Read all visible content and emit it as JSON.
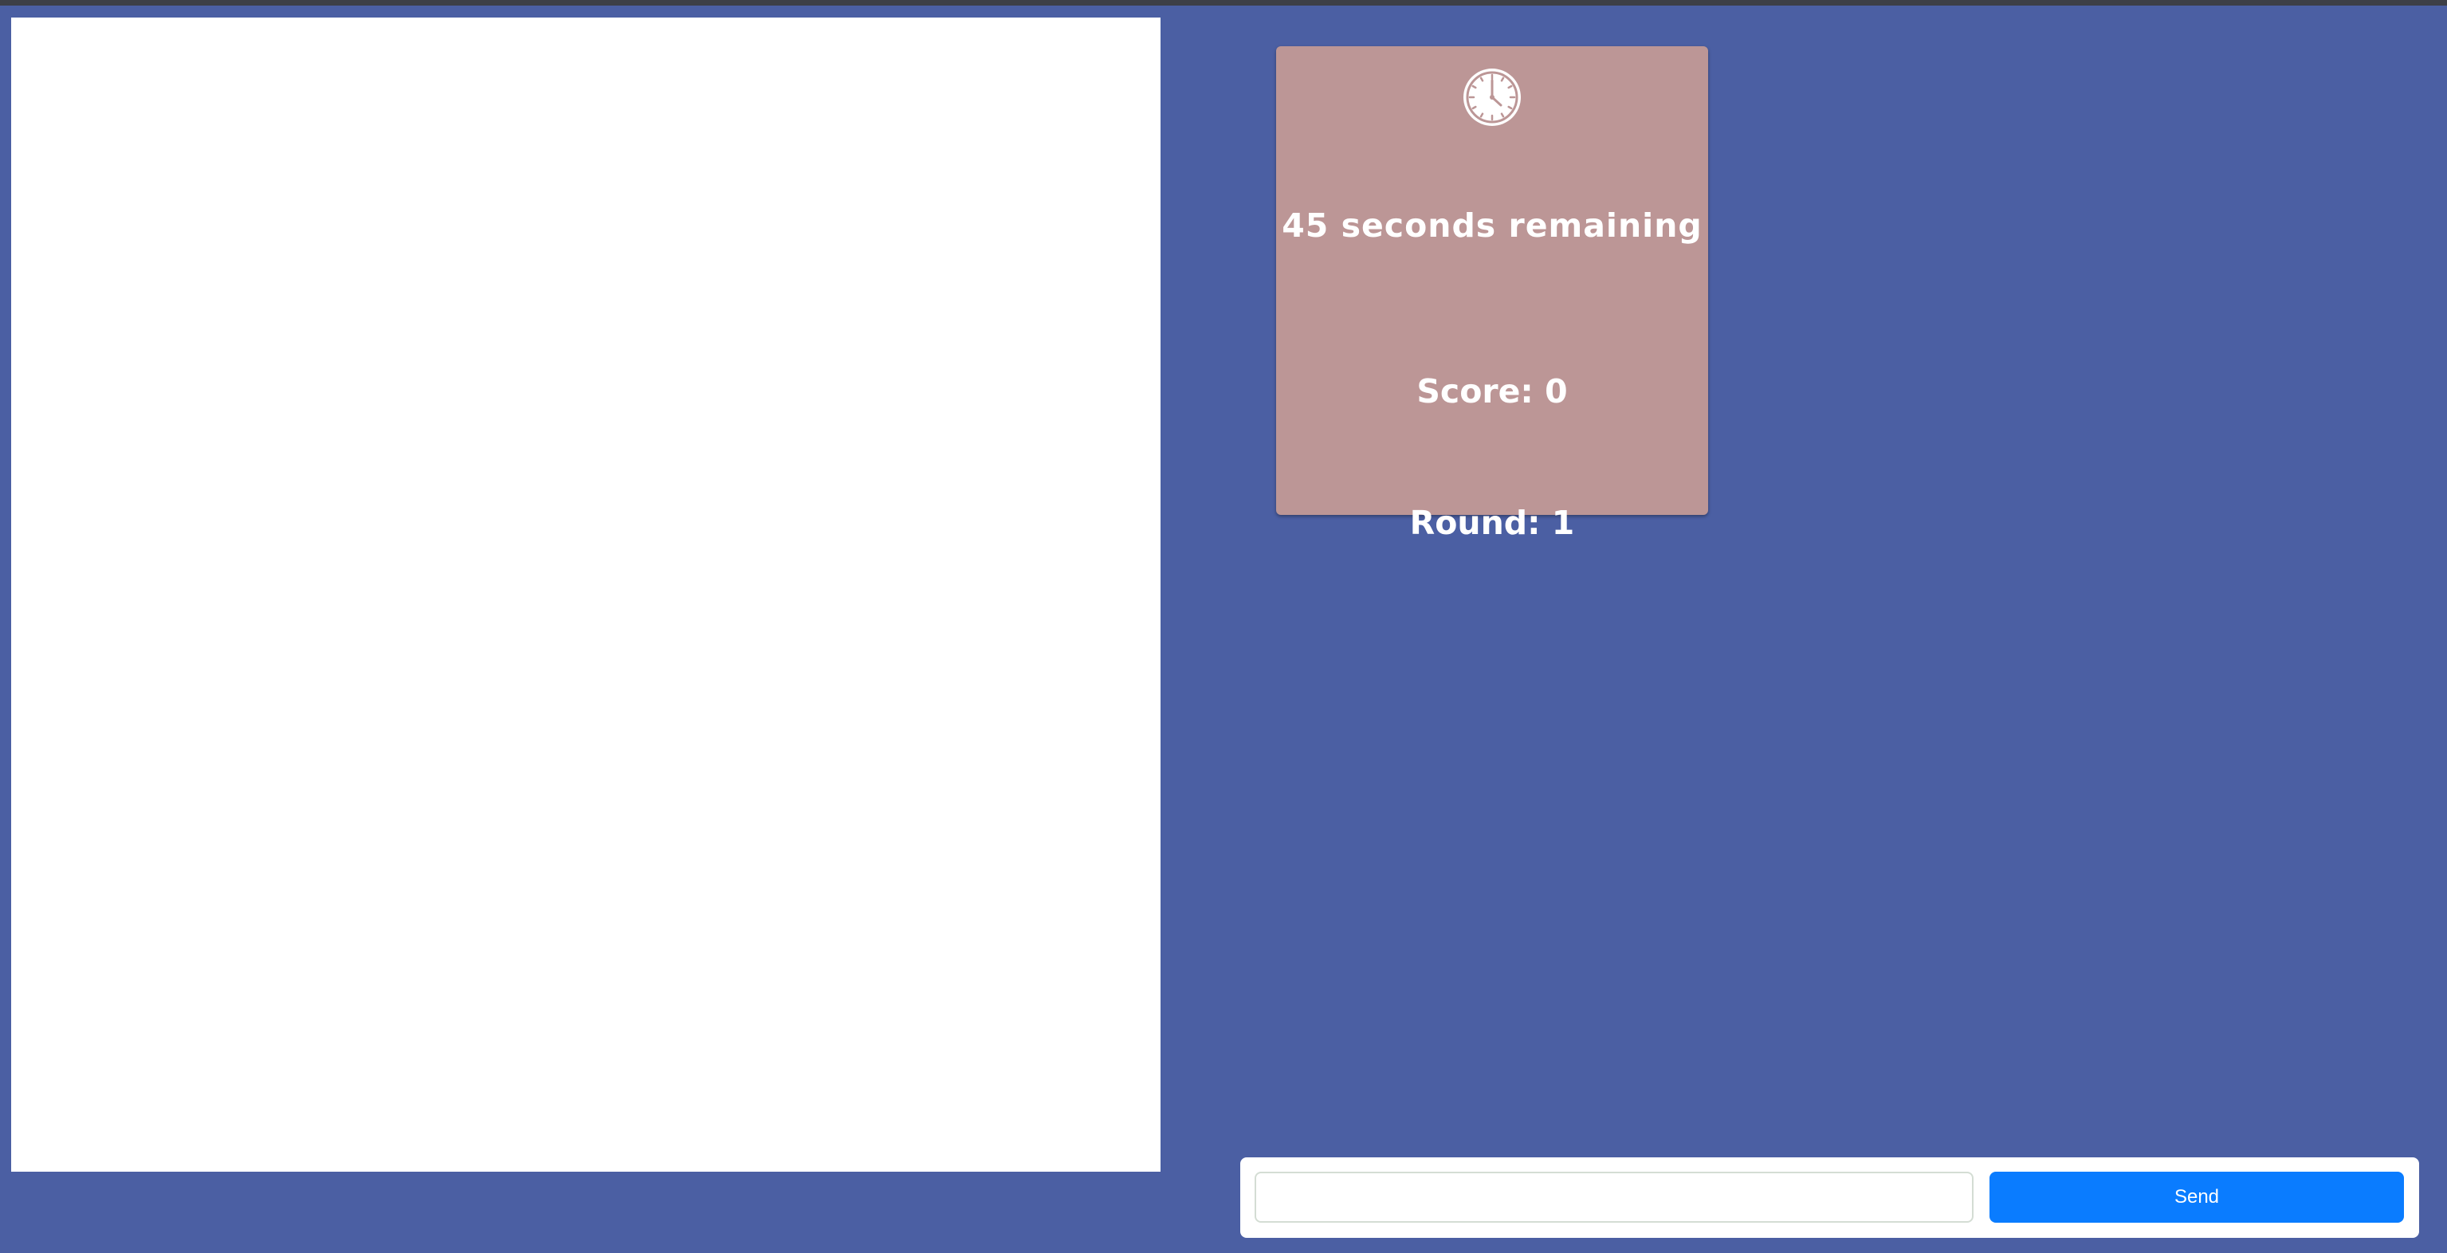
{
  "status": {
    "clock_icon": "clock-icon",
    "timer_text": "45 seconds remaining",
    "score_text": "Score: 0",
    "round_text": "Round: 1"
  },
  "chat": {
    "input_value": "",
    "input_placeholder": "",
    "send_label": "Send"
  },
  "colors": {
    "background": "#4b5fa3",
    "status_card": "#bc9696",
    "send_button": "#0a7cff",
    "canvas": "#ffffff"
  }
}
